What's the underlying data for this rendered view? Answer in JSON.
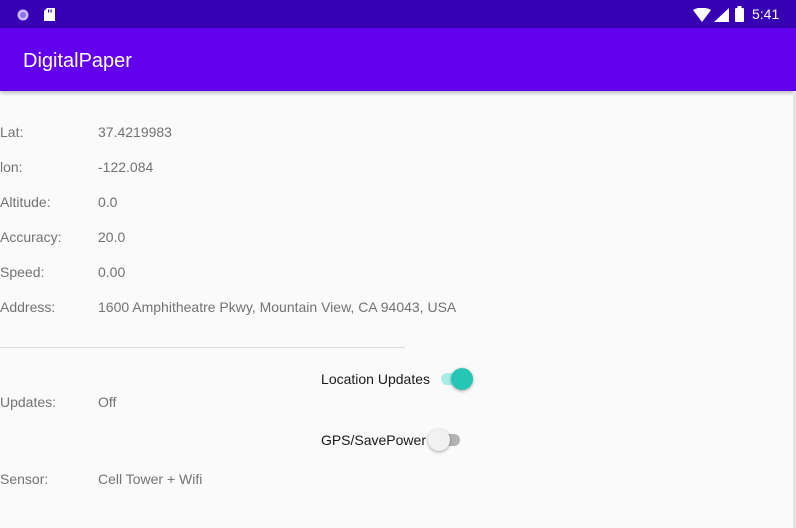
{
  "status_bar": {
    "time": "5:41",
    "left_icons": [
      "circle-dot-icon",
      "sd-card-icon"
    ],
    "right_icons": [
      "wifi-icon",
      "signal-icon",
      "battery-icon"
    ]
  },
  "app_bar": {
    "title": "DigitalPaper"
  },
  "location": {
    "rows": [
      {
        "label": "Lat:",
        "value": "37.4219983"
      },
      {
        "label": "lon:",
        "value": "-122.084"
      },
      {
        "label": "Altitude:",
        "value": "0.0"
      },
      {
        "label": "Accuracy:",
        "value": "20.0"
      },
      {
        "label": "Speed:",
        "value": "0.00"
      },
      {
        "label": "Address:",
        "value": "1600 Amphitheatre Pkwy, Mountain View, CA 94043, USA"
      }
    ]
  },
  "controls": {
    "location_updates": {
      "label": "Location Updates",
      "on": true
    },
    "gps_savepower": {
      "label": "GPS/SavePower",
      "on": false
    }
  },
  "status": {
    "updates_label": "Updates:",
    "updates_value": "Off",
    "sensor_label": "Sensor:",
    "sensor_value": "Cell Tower + Wifi"
  },
  "colors": {
    "status_bar": "#3700b3",
    "app_bar": "#6200ee",
    "switch_on": "#26c6b4",
    "text_secondary": "#737373"
  }
}
